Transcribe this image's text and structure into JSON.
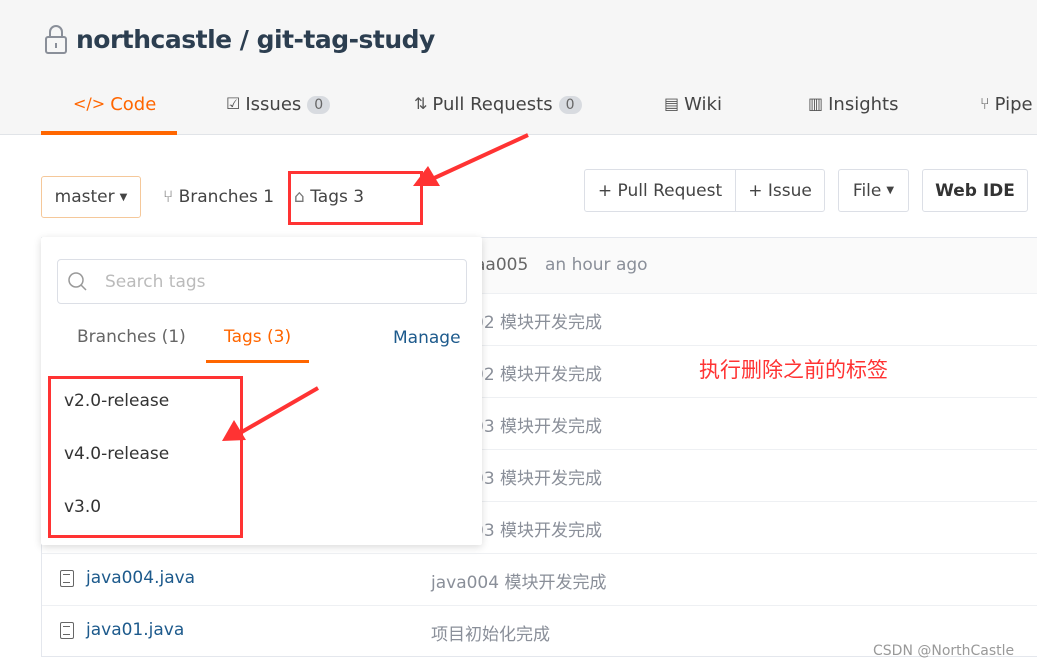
{
  "repo": {
    "title": "northcastle / git-tag-study",
    "lock_icon": "lock-icon"
  },
  "tabs": [
    {
      "label": "Code",
      "icon": "code-icon",
      "active": true
    },
    {
      "label": "Issues",
      "icon": "issues-icon",
      "count": "0"
    },
    {
      "label": "Pull Requests",
      "icon": "pull-request-icon",
      "count": "0"
    },
    {
      "label": "Wiki",
      "icon": "wiki-icon"
    },
    {
      "label": "Insights",
      "icon": "insights-icon"
    },
    {
      "label": "Pipe",
      "icon": "pipeline-icon"
    }
  ],
  "toolbar": {
    "branch": "master",
    "branches": "Branches 1",
    "tags": "Tags 3",
    "pull_request": "+ Pull Request",
    "issue": "+ Issue",
    "file": "File",
    "web_ide": "Web IDE"
  },
  "commit_header": {
    "author": "aa005",
    "time": "an hour ago"
  },
  "rows": [
    {
      "msg": "02 模块开发完成"
    },
    {
      "msg": "02 模块开发完成"
    },
    {
      "msg": "03 模块开发完成"
    },
    {
      "msg": "03 模块开发完成"
    },
    {
      "msg": "03 模块开发完成"
    },
    {
      "name": "java004.java",
      "msg": "java004 模块开发完成"
    },
    {
      "name": "java01.java",
      "msg": "项目初始化完成"
    }
  ],
  "dropdown": {
    "search_placeholder": "Search tags",
    "tab_branches": "Branches (1)",
    "tab_tags": "Tags (3)",
    "manage": "Manage",
    "tags": [
      "v2.0-release",
      "v4.0-release",
      "v3.0"
    ]
  },
  "annotation": "执行删除之前的标签",
  "watermark": "CSDN @NorthCastle",
  "colors": {
    "accent": "#ff6600",
    "annotation": "#ff3333",
    "link": "#1d5a8c"
  }
}
